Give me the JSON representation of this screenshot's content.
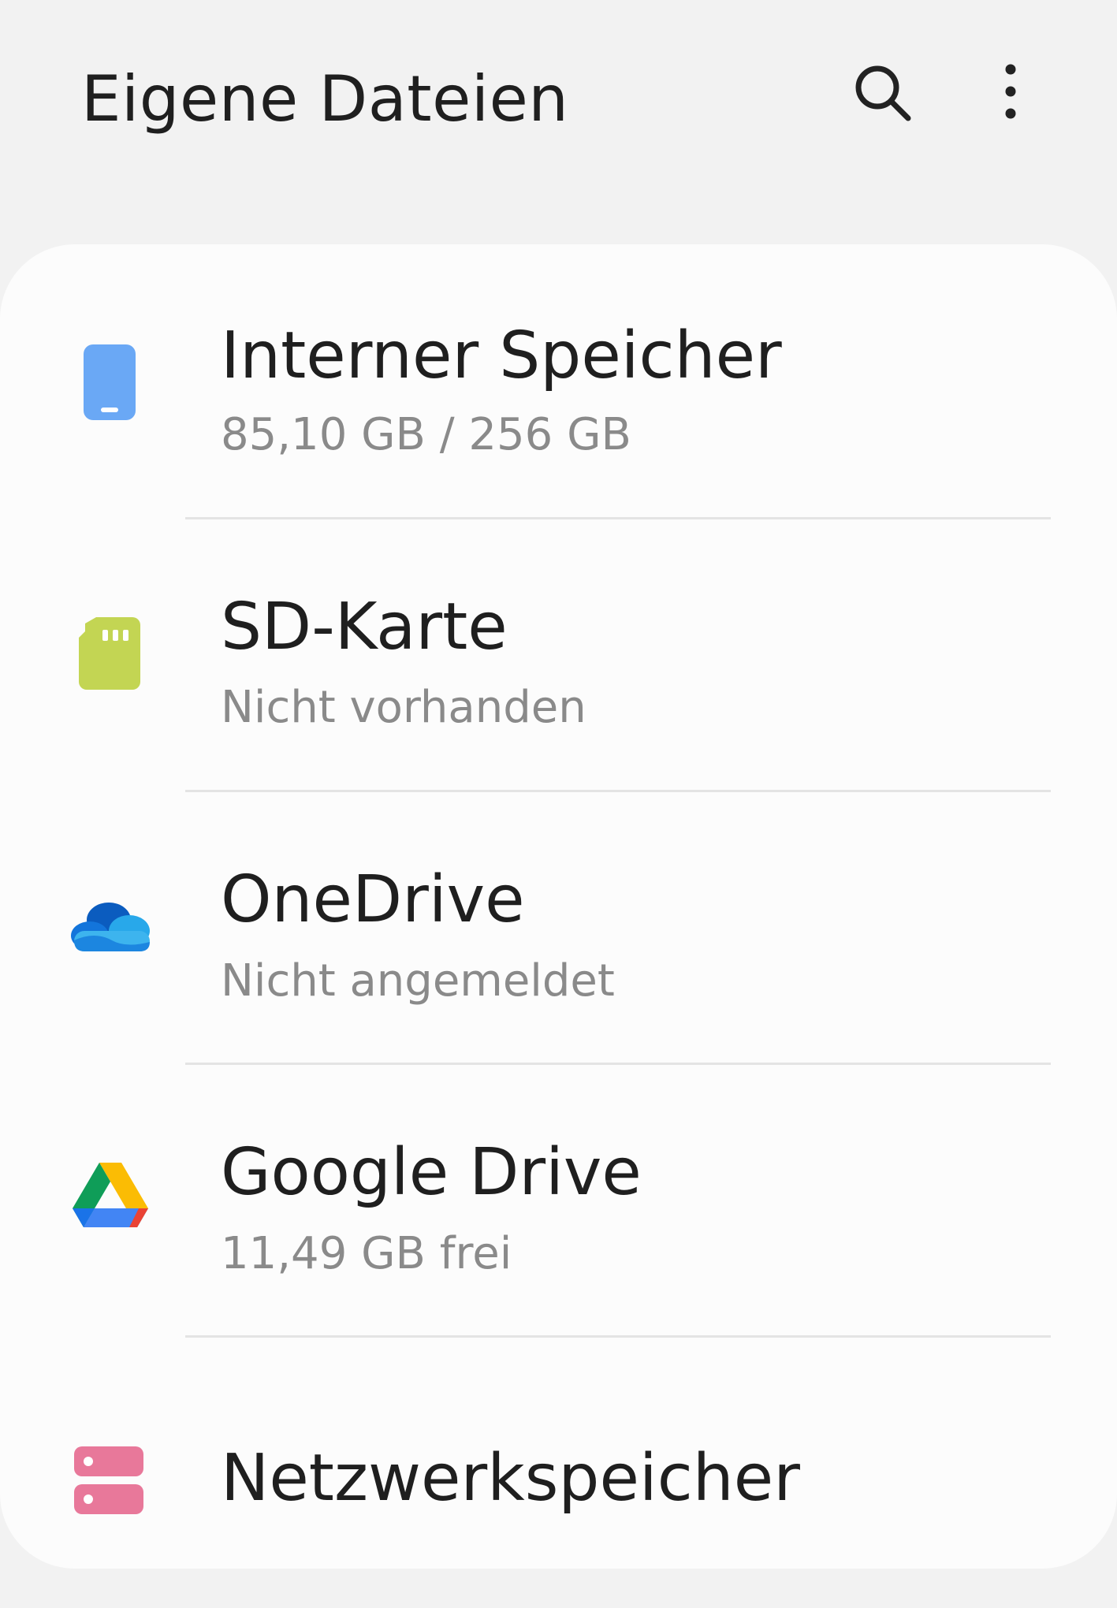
{
  "header": {
    "title": "Eigene Dateien",
    "search_icon": "search-icon",
    "more_icon": "more-vert-icon"
  },
  "storage_locations": [
    {
      "label": "Interner Speicher",
      "detail": "85,10 GB / 256 GB",
      "icon": "phone-storage-icon",
      "icon_color": "#6aa8f5"
    },
    {
      "label": "SD-Karte",
      "detail": "Nicht vorhanden",
      "icon": "sd-card-icon",
      "icon_color": "#c3d553"
    },
    {
      "label": "OneDrive",
      "detail": "Nicht angemeldet",
      "icon": "onedrive-icon",
      "icon_color": "#1e6fd0"
    },
    {
      "label": "Google Drive",
      "detail": "11,49 GB frei",
      "icon": "google-drive-icon",
      "icon_color": "#fbbc04"
    },
    {
      "label": "Netzwerkspeicher",
      "icon": "network-storage-icon",
      "icon_color": "#e8789a"
    }
  ]
}
